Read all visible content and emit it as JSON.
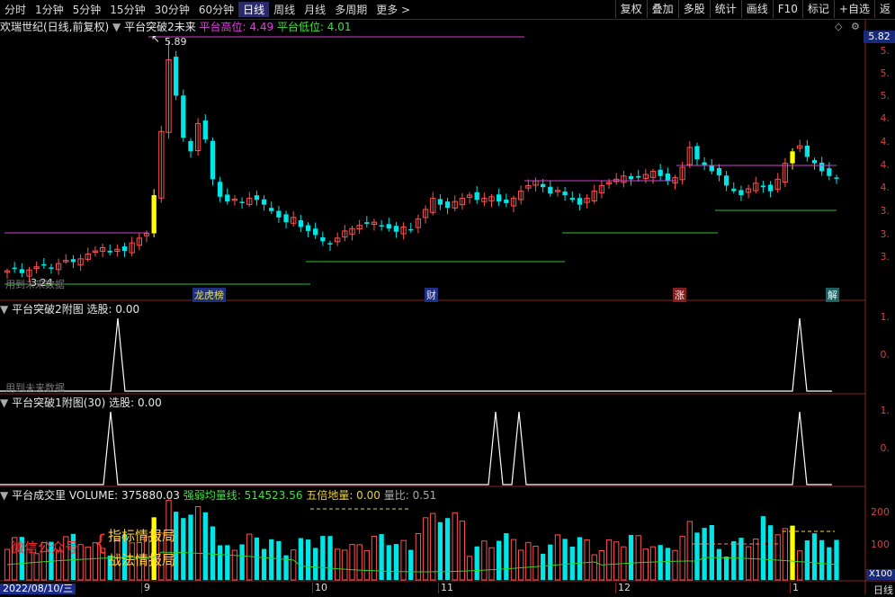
{
  "toolbar": {
    "periods": [
      "分时",
      "1分钟",
      "5分钟",
      "15分钟",
      "30分钟",
      "60分钟",
      "日线",
      "周线",
      "月线",
      "多周期",
      "更多 >"
    ],
    "active": "日线",
    "buttons": [
      "复权",
      "叠加",
      "多股",
      "统计",
      "画线",
      "F10",
      "标记",
      "+自选",
      "返"
    ]
  },
  "main_panel": {
    "stock_name": "欢瑞世纪(日线,前复权)",
    "indicator": "平台突破2未来",
    "high_label": "平台高位: 4.49",
    "low_label": "平台低位: 4.01",
    "peak_label": "5.89",
    "low_point_label": "3.24",
    "future_note": "用到未来数据",
    "price_tag": "5.82",
    "axis_labels": [
      "5.",
      "5.",
      "5.",
      "4.",
      "4.",
      "4.",
      "4.",
      "3.",
      "3.",
      "3."
    ],
    "event_marks": [
      "龙虎榜",
      "财",
      "涨",
      "解"
    ]
  },
  "sub_panel_1": {
    "title": "平台突破2附图",
    "value_label": "选股: 0.00",
    "future_note": "用到未来数据",
    "axis_labels": [
      "1.",
      "0."
    ]
  },
  "sub_panel_2": {
    "title": "平台突破1附图(30)",
    "value_label": "选股: 0.00",
    "axis_labels": [
      "1.",
      "0."
    ]
  },
  "volume_panel": {
    "title": "平台成交里",
    "volume_label": "VOLUME: 375880.03",
    "strong_label": "强弱均量线: 514523.56",
    "five_label": "五倍地量: 0.00",
    "ratio_label": "量比: 0.51",
    "axis_labels": [
      "200",
      "100",
      "X100"
    ],
    "watermark_left": "微信公众号",
    "watermark_1": "指标情报局",
    "watermark_2": "战法情报局"
  },
  "x_axis": {
    "date_label": "2022/08/10/三",
    "months": [
      "9",
      "10",
      "11",
      "12",
      "1"
    ],
    "period_label": "日线"
  },
  "colors": {
    "up": "#ff5050",
    "down": "#00e5e5",
    "platform_high": "#d040d0",
    "platform_low": "#30c030",
    "highlight": "#ffff00"
  }
}
